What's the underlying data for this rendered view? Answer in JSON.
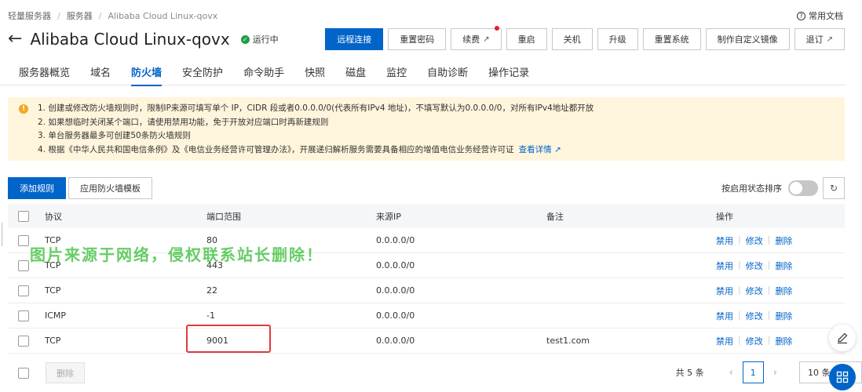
{
  "breadcrumb": [
    "轻量服务器",
    "服务器",
    "Alibaba Cloud Linux-qovx"
  ],
  "help_link": "常用文档",
  "title": "Alibaba Cloud Linux-qovx",
  "status": "运行中",
  "actions": {
    "remote": "远程连接",
    "reset_pwd": "重置密码",
    "renew": "续费",
    "restart": "重启",
    "shutdown": "关机",
    "upgrade": "升级",
    "reset_system": "重置系统",
    "custom_image": "制作自定义镜像",
    "refund": "退订"
  },
  "tabs": [
    "服务器概览",
    "域名",
    "防火墙",
    "安全防护",
    "命令助手",
    "快照",
    "磁盘",
    "监控",
    "自助诊断",
    "操作记录"
  ],
  "active_tab": "防火墙",
  "notice": {
    "lines": [
      "1. 创建或修改防火墙规则时，限制IP来源可填写单个 IP，CIDR 段或者0.0.0.0/0(代表所有IPv4 地址)，不填写默认为0.0.0.0/0，对所有IPv4地址都开放",
      "2. 如果想临时关闭某个端口，请使用禁用功能，免于开放对应端口时再新建规则",
      "3. 单台服务器最多可创建50条防火墙规则",
      "4. 根据《中华人民共和国电信条例》及《电信业务经营许可管理办法》，开展递归解析服务需要具备相应的增值电信业务经营许可证"
    ],
    "link": "查看详情"
  },
  "toolbar": {
    "add_rule": "添加规则",
    "apply_template": "应用防火墙模板",
    "sort_label": "按启用状态排序"
  },
  "table": {
    "headers": [
      "协议",
      "端口范围",
      "来源IP",
      "备注",
      "操作"
    ],
    "rows": [
      {
        "protocol": "TCP",
        "port": "80",
        "source": "0.0.0.0/0",
        "note": ""
      },
      {
        "protocol": "TCP",
        "port": "443",
        "source": "0.0.0.0/0",
        "note": ""
      },
      {
        "protocol": "TCP",
        "port": "22",
        "source": "0.0.0.0/0",
        "note": ""
      },
      {
        "protocol": "ICMP",
        "port": "-1",
        "source": "0.0.0.0/0",
        "note": ""
      },
      {
        "protocol": "TCP",
        "port": "9001",
        "source": "0.0.0.0/0",
        "note": "test1.com"
      }
    ],
    "ops": {
      "disable": "禁用",
      "edit": "修改",
      "delete": "删除"
    }
  },
  "footer": {
    "delete": "删除",
    "total": "共 5 条",
    "page": "1",
    "page_size": "10 条/页"
  },
  "watermark": "图片来源于网络，侵权联系站长删除！",
  "colors": {
    "primary": "#0064c8",
    "notice_bg": "#fff5dc",
    "running": "#1f9e45",
    "highlight": "#e03a3a"
  }
}
